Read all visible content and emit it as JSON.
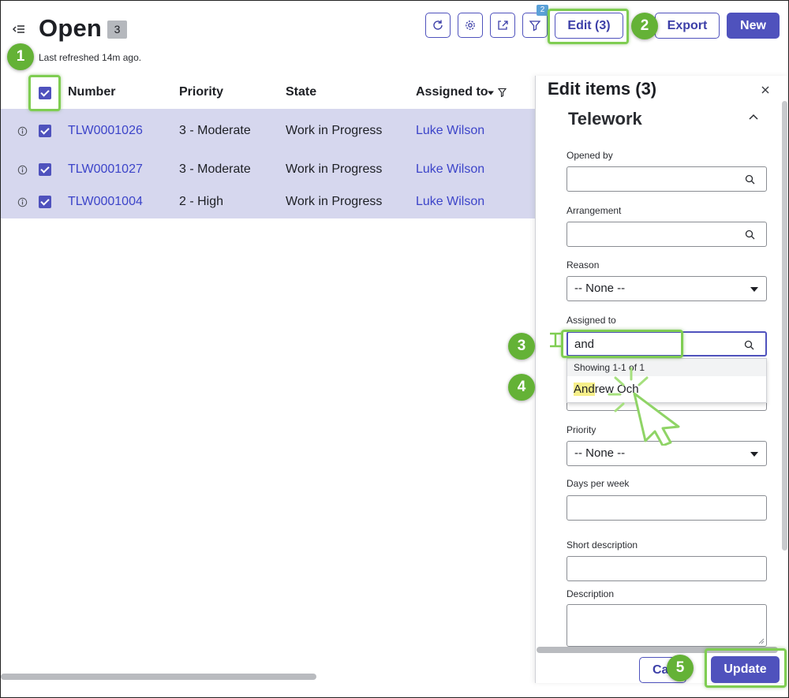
{
  "header": {
    "title": "Open",
    "count": "3",
    "last_refreshed": "Last refreshed 14m ago.",
    "filter_badge": "2",
    "edit_label": "Edit (3)",
    "export_label": "Export",
    "new_label": "New"
  },
  "table": {
    "columns": [
      "Number",
      "Priority",
      "State",
      "Assigned to"
    ],
    "rows": [
      {
        "number": "TLW0001026",
        "priority": "3 - Moderate",
        "state": "Work in Progress",
        "assigned_to": "Luke Wilson"
      },
      {
        "number": "TLW0001027",
        "priority": "3 - Moderate",
        "state": "Work in Progress",
        "assigned_to": "Luke Wilson"
      },
      {
        "number": "TLW0001004",
        "priority": "2 - High",
        "state": "Work in Progress",
        "assigned_to": "Luke Wilson"
      }
    ]
  },
  "panel": {
    "title": "Edit items (3)",
    "section": "Telework",
    "fields": {
      "opened_by": {
        "label": "Opened by",
        "value": ""
      },
      "arrangement": {
        "label": "Arrangement",
        "value": ""
      },
      "reason": {
        "label": "Reason",
        "value": "-- None --"
      },
      "assigned_to": {
        "label": "Assigned to",
        "value": "and"
      },
      "priority": {
        "label": "Priority",
        "value": "-- None --"
      },
      "days_per_week": {
        "label": "Days per week",
        "value": ""
      },
      "short_description": {
        "label": "Short description",
        "value": ""
      },
      "description": {
        "label": "Description",
        "value": ""
      }
    },
    "dropdown": {
      "header": "Showing 1-1 of 1",
      "match": "And",
      "rest": "rew Och"
    },
    "cancel_label": "Cancel",
    "update_label": "Update"
  },
  "callouts": [
    "1",
    "2",
    "3",
    "4",
    "5"
  ],
  "colors": {
    "primary": "#4f52bd",
    "link": "#3c44c9",
    "selected_row": "#d6d7ee",
    "callout_green": "#64b236",
    "highlight_green": "#7fcd52"
  }
}
